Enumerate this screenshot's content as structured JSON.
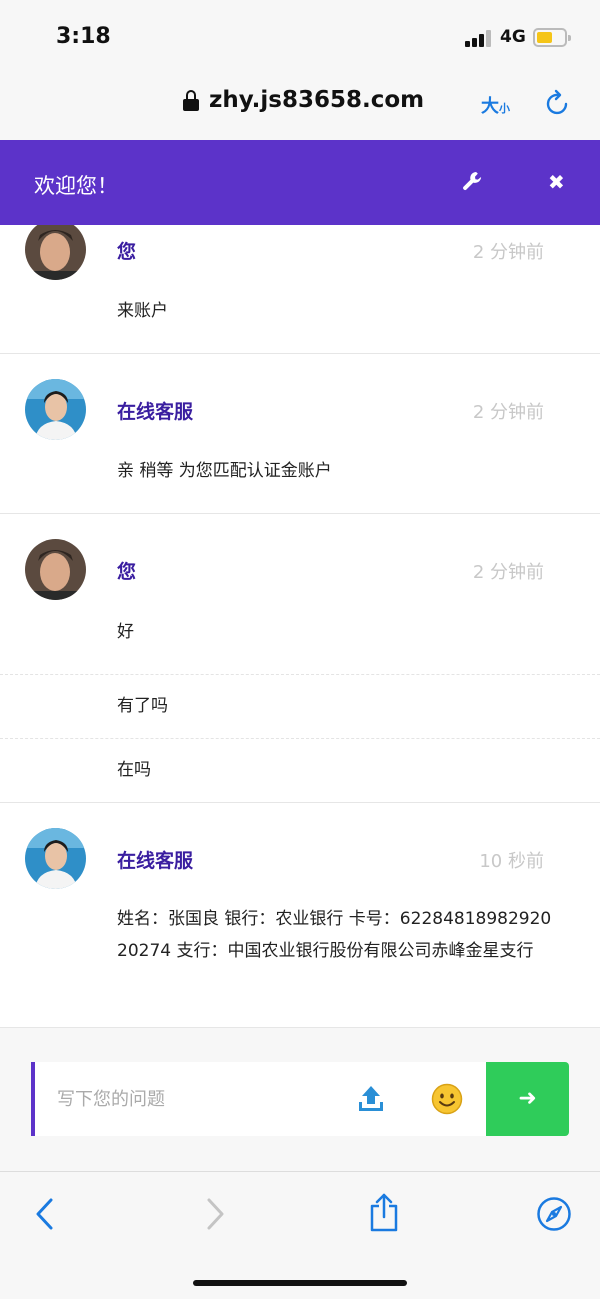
{
  "status_bar": {
    "time": "3:18",
    "network": "4G"
  },
  "browser": {
    "url": "zhy.js83658.com",
    "text_size_big": "大",
    "text_size_small": "小"
  },
  "chat": {
    "title": "欢迎您！",
    "close_symbol": "✖",
    "accent_color": "#5c33c9",
    "messages": [
      {
        "sender": "您",
        "time": "2 分钟前",
        "lines": [
          "来账户"
        ]
      },
      {
        "sender": "在线客服",
        "time": "2 分钟前",
        "lines": [
          "亲 稍等 为您匹配认证金账户"
        ]
      },
      {
        "sender": "您",
        "time": "2 分钟前",
        "lines": [
          "好",
          "有了吗",
          "在吗"
        ]
      },
      {
        "sender": "在线客服",
        "time": "10 秒前",
        "lines": [
          "姓名：张国良 银行：农业银行 卡号：6228481898292020274 支行：中国农业银行股份有限公司赤峰金星支行"
        ]
      }
    ]
  },
  "composer": {
    "placeholder": "写下您的问题",
    "send_symbol": "➜",
    "send_color": "#2fcc5a"
  },
  "icons": [
    "lock-icon",
    "reload-icon",
    "wrench-icon",
    "close-icon",
    "upload-icon",
    "emoji-icon",
    "back-icon",
    "forward-icon",
    "share-icon",
    "compass-icon"
  ]
}
